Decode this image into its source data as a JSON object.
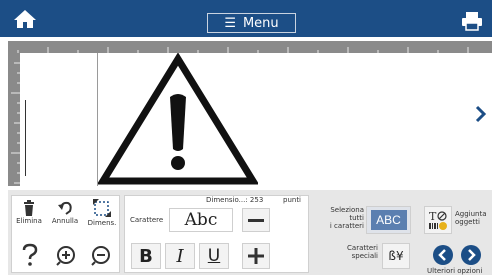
{
  "topbar": {
    "menu_label": "Menu",
    "home_icon": "home-icon",
    "print_icon": "print-icon"
  },
  "toolbar": {
    "delete_label": "Elimina",
    "undo_label": "Annulla",
    "size_label": "Dimens.",
    "help_icon": "help-icon",
    "zoom_in_icon": "zoom-in-icon",
    "zoom_out_icon": "zoom-out-icon",
    "font_label": "Carattere",
    "font_preview": "Abc",
    "font_size_label": "Dimensio...: 253",
    "font_size_unit": "punti",
    "bold_label": "B",
    "italic_label": "I",
    "underline_label": "U",
    "select_all_line1": "Seleziona",
    "select_all_line2": "tutti",
    "select_all_line3": "i caratteri",
    "select_all_box": "ABC",
    "special_chars_line1": "Caratteri",
    "special_chars_line2": "speciali",
    "special_chars_glyph": "ß¥",
    "add_objects_line1": "Aggiunta",
    "add_objects_line2": "oggetti",
    "more_options_label": "Ulteriori opzioni"
  },
  "colors": {
    "accent": "#1c4e86",
    "select_all_box": "#5b7fb0"
  }
}
